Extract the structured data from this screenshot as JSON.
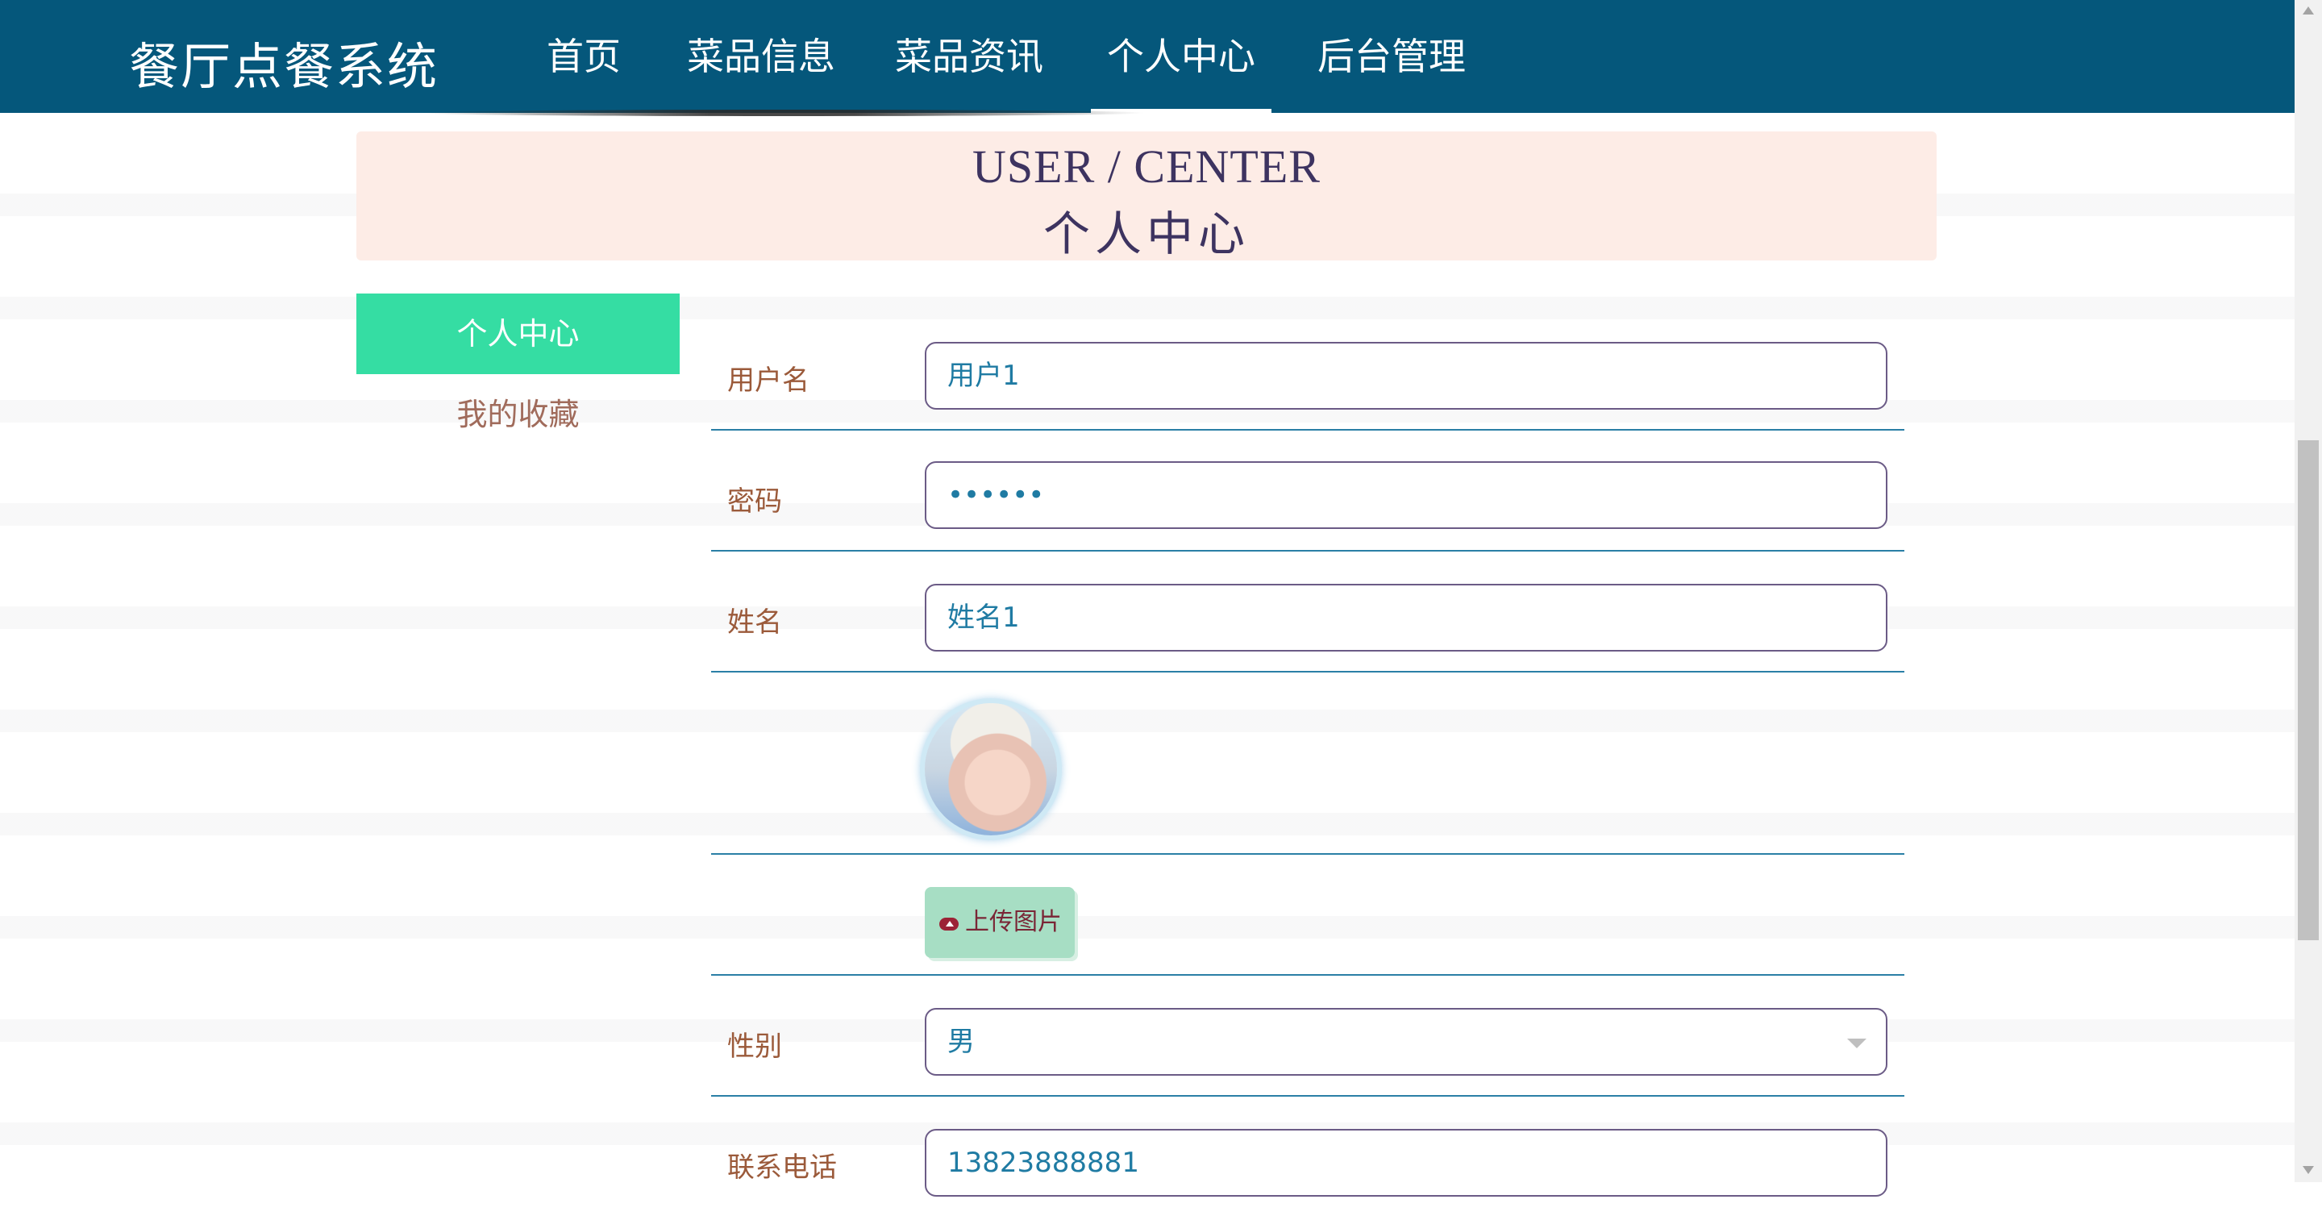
{
  "app": {
    "brand": "餐厅点餐系统"
  },
  "nav": {
    "items": [
      {
        "label": "首页"
      },
      {
        "label": "菜品信息"
      },
      {
        "label": "菜品资讯"
      },
      {
        "label": "个人中心",
        "active": true
      },
      {
        "label": "后台管理"
      }
    ]
  },
  "banner": {
    "en_title": "USER / CENTER",
    "cn_title": "个人中心"
  },
  "sidebar": {
    "items": [
      {
        "label": "个人中心",
        "active": true
      },
      {
        "label": "我的收藏"
      }
    ]
  },
  "form": {
    "username_label": "用户名",
    "username_value": "用户1",
    "password_label": "密码",
    "password_value": "••••••",
    "name_label": "姓名",
    "name_value": "姓名1",
    "upload_label": "上传图片",
    "gender_label": "性别",
    "gender_value": "男",
    "phone_label": "联系电话",
    "phone_value": "13823888881"
  },
  "colors": {
    "navbar": "#05577b",
    "sidebar_active": "#35dda3",
    "banner_bg": "#fdece6",
    "label": "#9b5a3a",
    "field_text": "#1f7ba3"
  }
}
